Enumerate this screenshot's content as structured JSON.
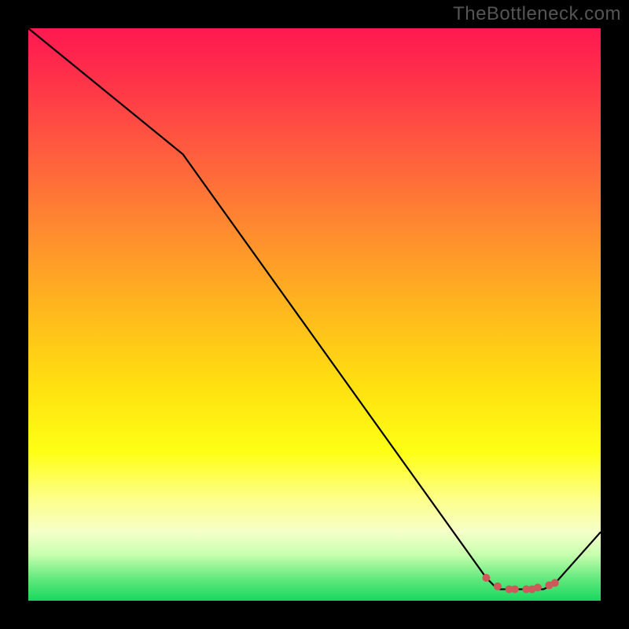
{
  "watermark": "TheBottleneck.com",
  "chart_data": {
    "type": "line",
    "title": "",
    "xlabel": "",
    "ylabel": "",
    "xlim": [
      0,
      100
    ],
    "ylim": [
      0,
      100
    ],
    "grid": false,
    "legend": false,
    "gradient_stops": [
      {
        "pos": 0,
        "color": "#ff1851"
      },
      {
        "pos": 8,
        "color": "#ff2f4a"
      },
      {
        "pos": 22,
        "color": "#ff5e3e"
      },
      {
        "pos": 35,
        "color": "#ff8a2f"
      },
      {
        "pos": 48,
        "color": "#ffb41f"
      },
      {
        "pos": 62,
        "color": "#ffdf10"
      },
      {
        "pos": 74,
        "color": "#feff14"
      },
      {
        "pos": 82,
        "color": "#fdff86"
      },
      {
        "pos": 88,
        "color": "#f6ffc9"
      },
      {
        "pos": 92,
        "color": "#c6ffad"
      },
      {
        "pos": 96,
        "color": "#66e97e"
      },
      {
        "pos": 100,
        "color": "#18d85f"
      }
    ],
    "series": [
      {
        "name": "bottleneck-curve",
        "color": "#000000",
        "width": 2.2,
        "x": [
          0,
          27,
          80,
          82,
          85,
          88,
          90,
          92,
          100
        ],
        "values": [
          100,
          78,
          4,
          2,
          2,
          2,
          2,
          3,
          12
        ]
      }
    ],
    "markers": {
      "name": "highlight-dots",
      "color": "#cc5a5a",
      "radius": 5,
      "x": [
        80,
        82,
        84,
        85,
        87,
        88,
        89,
        91,
        92
      ],
      "values": [
        4,
        2.5,
        2,
        2,
        2,
        2,
        2.3,
        2.7,
        3.1
      ]
    }
  }
}
